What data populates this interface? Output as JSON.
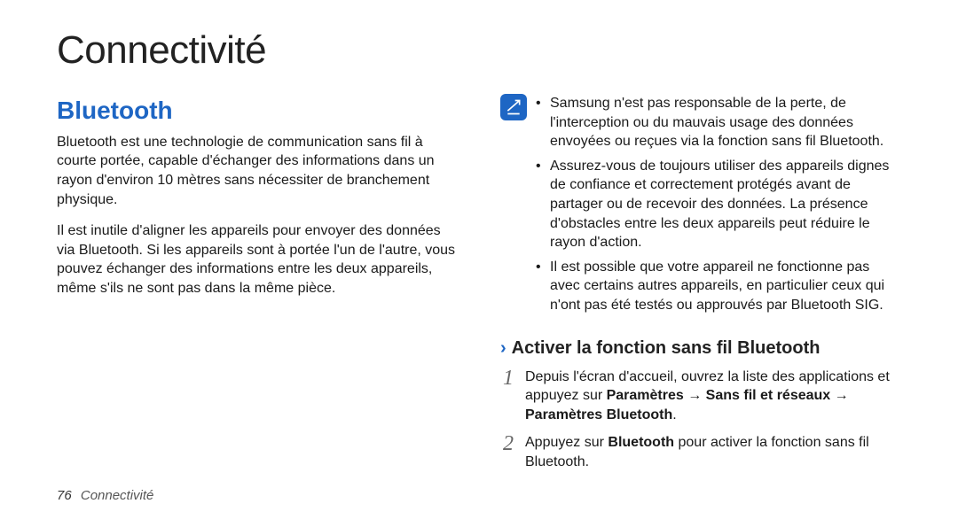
{
  "main_title": "Connectivité",
  "left": {
    "section_title": "Bluetooth",
    "para1": "Bluetooth est une technologie de communication sans fil à courte portée, capable d'échanger des informations dans un rayon d'environ 10 mètres sans nécessiter de branchement physique.",
    "para2": "Il est inutile d'aligner les appareils pour envoyer des données via Bluetooth. Si les appareils sont à portée l'un de l'autre, vous pouvez échanger des informations entre les deux appareils, même s'ils ne sont pas dans la même pièce."
  },
  "right": {
    "notes": [
      "Samsung n'est pas responsable de la perte, de l'interception ou du mauvais usage des données envoyées ou reçues via la fonction sans fil Bluetooth.",
      "Assurez-vous de toujours utiliser des appareils dignes de confiance et correctement protégés avant de partager ou de recevoir des données. La présence d'obstacles entre les deux appareils peut réduire le rayon d'action.",
      "Il est possible que votre appareil ne fonctionne pas avec certains autres appareils, en particulier ceux qui n'ont pas été testés ou approuvés par Bluetooth SIG."
    ],
    "sub_heading": "Activer la fonction sans fil Bluetooth",
    "steps": [
      {
        "num": "1",
        "pre": "Depuis l'écran d'accueil, ouvrez la liste des applications et appuyez sur ",
        "bold1": "Paramètres",
        "arrow1": " → ",
        "bold2": "Sans fil et réseaux",
        "arrow2": " → ",
        "bold3": "Paramètres Bluetooth",
        "post": "."
      },
      {
        "num": "2",
        "pre": "Appuyez sur ",
        "bold1": "Bluetooth",
        "post": " pour activer la fonction sans fil Bluetooth."
      }
    ]
  },
  "footer": {
    "page_num": "76",
    "section": "Connectivité"
  }
}
